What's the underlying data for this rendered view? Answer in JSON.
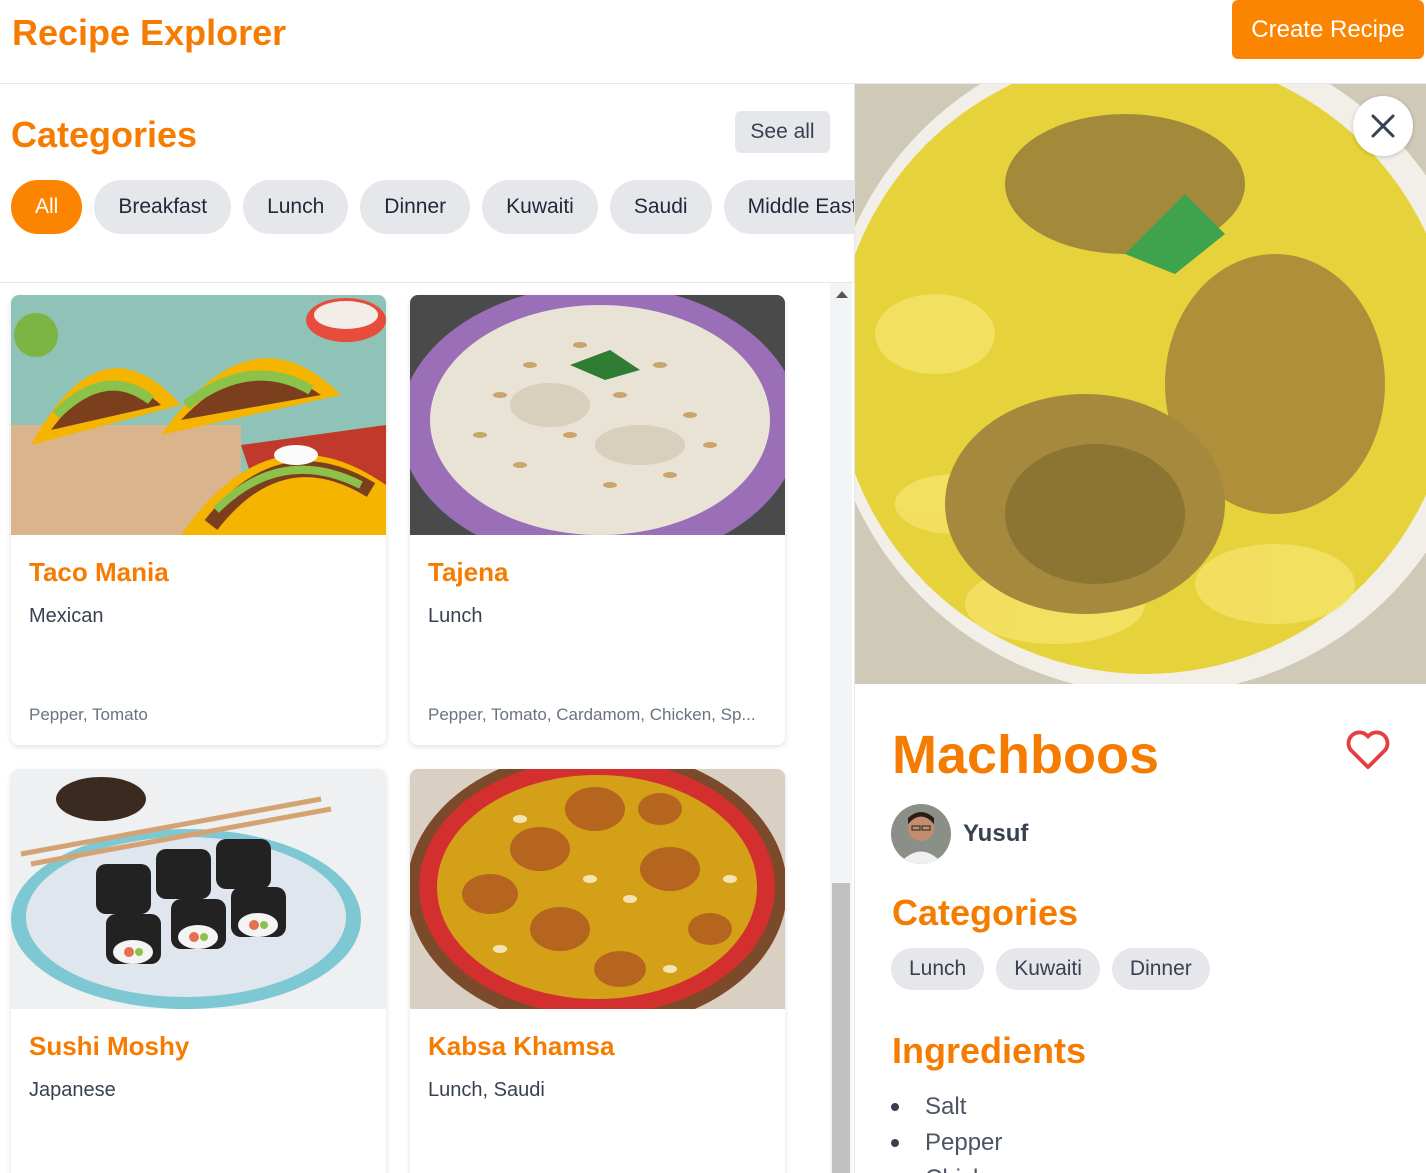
{
  "header": {
    "title": "Recipe Explorer",
    "create_label": "Create Recipe"
  },
  "categories": {
    "title": "Categories",
    "see_all": "See all",
    "chips": [
      "All",
      "Breakfast",
      "Lunch",
      "Dinner",
      "Kuwaiti",
      "Saudi",
      "Middle Eastern"
    ],
    "active": "All"
  },
  "recipes": [
    {
      "title": "Taco Mania",
      "category": "Mexican",
      "ingredients": "Pepper, Tomato"
    },
    {
      "title": "Tajena",
      "category": "Lunch",
      "ingredients": "Pepper, Tomato, Cardamom, Chicken, Sp..."
    },
    {
      "title": "Sushi Moshy",
      "category": "Japanese",
      "ingredients": ""
    },
    {
      "title": "Kabsa Khamsa",
      "category": "Lunch, Saudi",
      "ingredients": ""
    }
  ],
  "detail": {
    "title": "Machboos",
    "author": "Yusuf",
    "categories_title": "Categories",
    "categories": [
      "Lunch",
      "Kuwaiti",
      "Dinner"
    ],
    "ingredients_title": "Ingredients",
    "ingredients": [
      "Salt",
      "Pepper",
      "Chicken"
    ]
  },
  "icons": {
    "close": "close-icon",
    "favorite": "heart-icon",
    "scroll_up": "chevron-up-icon"
  },
  "colors": {
    "accent": "#fb8500",
    "title": "#f57c00",
    "chip_bg": "#e5e7eb",
    "heart": "#e53e3e"
  }
}
